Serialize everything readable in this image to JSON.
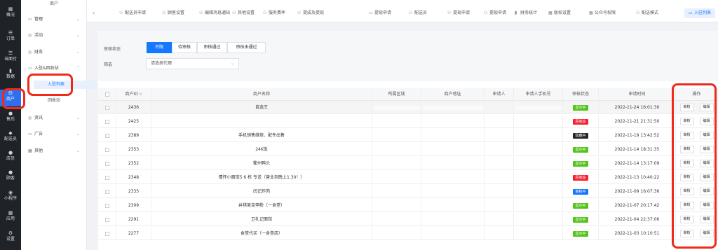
{
  "rail": {
    "items": [
      {
        "label": "概况",
        "icon": "overview-icon",
        "glyph": "▦"
      },
      {
        "label": "订单",
        "icon": "order-icon",
        "glyph": "☰"
      },
      {
        "label": "当面付",
        "icon": "payment-icon",
        "glyph": "☰"
      },
      {
        "label": "数据",
        "icon": "data-icon",
        "glyph": "▮"
      },
      {
        "label": "商户",
        "icon": "merchant-icon",
        "glyph": "⊟"
      },
      {
        "label": "售后",
        "icon": "aftersale-icon",
        "glyph": "●"
      },
      {
        "label": "配送员",
        "icon": "courier-icon",
        "glyph": "◆"
      },
      {
        "label": "店员",
        "icon": "clerk-icon",
        "glyph": "●"
      },
      {
        "label": "顾客",
        "icon": "customer-icon",
        "glyph": "●"
      },
      {
        "label": "小程序",
        "icon": "miniprogram-icon",
        "glyph": "◉"
      },
      {
        "label": "应用",
        "icon": "apps-icon",
        "glyph": "▦"
      },
      {
        "label": "设置",
        "icon": "settings-icon",
        "glyph": "⚙"
      }
    ],
    "active_index": 4
  },
  "menu": {
    "title": "商户",
    "groups": [
      {
        "label": "管理",
        "icon": "manage-icon",
        "glyph": "▭",
        "expanded": false
      },
      {
        "label": "活动",
        "icon": "activity-icon",
        "glyph": "◎",
        "expanded": false
      },
      {
        "label": "财务",
        "icon": "finance-icon",
        "glyph": "◎",
        "expanded": false
      },
      {
        "label": "入驻&回收站",
        "icon": "enter-icon",
        "glyph": "▭",
        "expanded": true
      },
      {
        "label": "资讯",
        "icon": "news-icon",
        "glyph": "◎",
        "expanded": false
      },
      {
        "label": "广告",
        "icon": "ad-icon",
        "glyph": "▭",
        "expanded": false
      },
      {
        "label": "其他",
        "icon": "other-icon",
        "glyph": "▦",
        "expanded": false
      }
    ],
    "subitems": [
      {
        "label": "入驻列表",
        "active": true
      },
      {
        "label": "回收站",
        "active": false
      }
    ]
  },
  "tabs": [
    {
      "label": "配送员申请",
      "glyph": "⚇"
    },
    {
      "label": "顾客设置",
      "glyph": "⚇"
    },
    {
      "label": "编辑消息通知",
      "glyph": "⚇"
    },
    {
      "label": "其他设置",
      "glyph": "⚇"
    },
    {
      "label": "服务费率",
      "glyph": "⚇"
    },
    {
      "label": "提成及提现",
      "glyph": "⚇"
    },
    {
      "label": "提现申请",
      "glyph": "▭"
    },
    {
      "label": "配送员",
      "glyph": "⚇"
    },
    {
      "label": "提现申请",
      "glyph": "⚇"
    },
    {
      "label": "提现申请",
      "glyph": "⚇"
    },
    {
      "label": "财务统计",
      "glyph": "▮"
    },
    {
      "label": "版权设置",
      "glyph": "▦"
    },
    {
      "label": "公众号权限",
      "glyph": "▦"
    },
    {
      "label": "配送模式",
      "glyph": "⚇"
    },
    {
      "label": "入驻列表",
      "glyph": "▭",
      "active": true
    }
  ],
  "filters": {
    "status_label": "审核状态",
    "status_options": [
      "不限",
      "待审核",
      "审核通过",
      "审核未通过"
    ],
    "status_selected": 0,
    "filter_label": "筛选",
    "agent_placeholder": "请选择代理"
  },
  "table": {
    "headers": [
      "商户ID",
      "商户名称",
      "所属区域",
      "商户地址",
      "申请人",
      "申请人手机号",
      "审核状态",
      "申请时间",
      "操作"
    ],
    "rows": [
      {
        "id": "2436",
        "name": "自选王",
        "status": "显示中",
        "status_color": "#52c41a",
        "time": "2022-11-24 16:01:30"
      },
      {
        "id": "2425",
        "name": "　",
        "status": "回收站",
        "status_color": "#f5222d",
        "time": "2022-11-21 21:31:50"
      },
      {
        "id": "2389",
        "name": "手机销售维修、配件出售",
        "status": "隐藏中",
        "status_color": "#262626",
        "time": "2022-11-19 13:42:52"
      },
      {
        "id": "2353",
        "name": "24K饭",
        "status": "显示中",
        "status_color": "#52c41a",
        "time": "2022-11-14 18:31:35"
      },
      {
        "id": "2352",
        "name": "衢州鸭头",
        "status": "显示中",
        "status_color": "#52c41a",
        "time": "2022-11-14 13:17:09"
      },
      {
        "id": "2348",
        "name": "情怀小面馆5 6 栋 专送（营业到晚上1.30！）",
        "status": "回收站",
        "status_color": "#f5222d",
        "time": "2022-11-13 10:40:22"
      },
      {
        "id": "2335",
        "name": "闰记炸肉",
        "status": "审核中",
        "status_color": "#1677ff",
        "time": "2022-11-09 16:07:36"
      },
      {
        "id": "2309",
        "name": "井祺美克甲粉（一食堂）",
        "status": "显示中",
        "status_color": "#52c41a",
        "time": "2022-11-07 20:17:42"
      },
      {
        "id": "2291",
        "name": "卫礼记面馆",
        "status": "显示中",
        "status_color": "#52c41a",
        "time": "2022-11-04 22:37:06"
      },
      {
        "id": "2277",
        "name": "食堂代买（一食堂店）",
        "status": "显示中",
        "status_color": "#52c41a",
        "time": "2022-11-03 10:10:51"
      }
    ],
    "actions": {
      "review": "审核",
      "edit": "编辑"
    }
  }
}
